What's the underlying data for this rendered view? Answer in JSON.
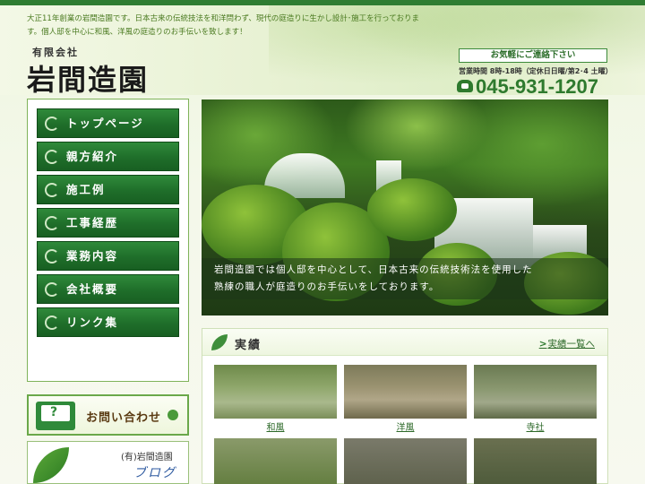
{
  "header": {
    "tagline": "大正11年創業の岩間造園です。日本古来の伝統技法を和洋問わず、現代の庭造りに生かし設計･施工を行っております。個人邸を中心に和風、洋風の庭造りのお手伝いを致します！",
    "company_type": "有限会社",
    "logo": "岩間造園",
    "contact_title": "お気軽にご連絡下さい",
    "hours": "営業時間 8時-18時（定休日日曜/第2･4 土曜）",
    "phone": "045-931-1207"
  },
  "nav": {
    "items": [
      {
        "label": "トップページ"
      },
      {
        "label": "親方紹介"
      },
      {
        "label": "施工例"
      },
      {
        "label": "工事経歴"
      },
      {
        "label": "業務内容"
      },
      {
        "label": "会社概要"
      },
      {
        "label": "リンク集"
      }
    ]
  },
  "banners": {
    "contact": "お問い合わせ",
    "blog_company": "(有)岩間造園",
    "blog": "ブログ"
  },
  "hero": {
    "caption_line1": "岩間造園では個人邸を中心として、日本古来の伝統技術法を使用した",
    "caption_line2": "熟練の職人が庭造りのお手伝いをしております。"
  },
  "results": {
    "title": "実績",
    "more": "実績一覧へ",
    "items": [
      {
        "caption": "和風"
      },
      {
        "caption": "洋風"
      },
      {
        "caption": "寺社"
      },
      {
        "caption": ""
      },
      {
        "caption": ""
      },
      {
        "caption": ""
      }
    ]
  },
  "colors": {
    "nav_green": "#1f6e2a",
    "accent_green": "#2e7a2e",
    "link_green": "#2e6a2a"
  }
}
